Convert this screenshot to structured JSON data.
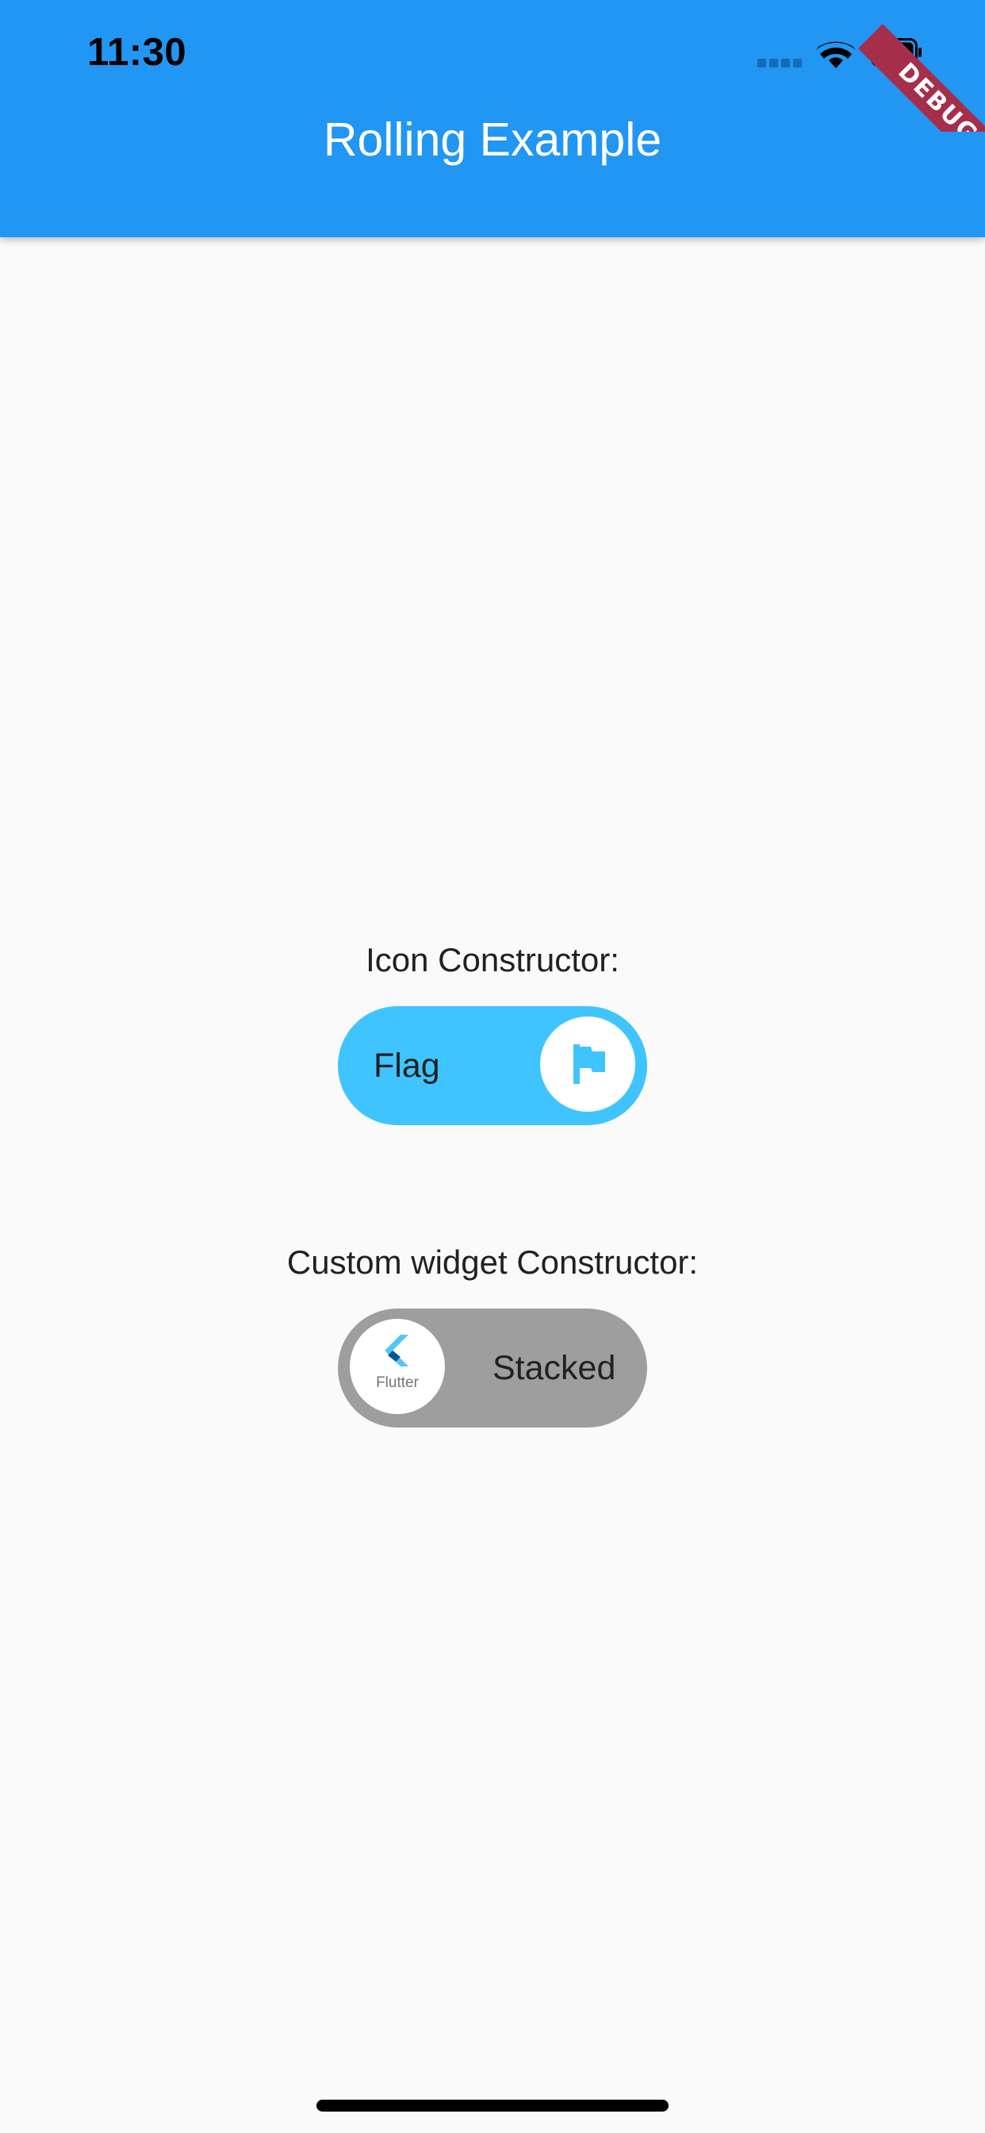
{
  "status_bar": {
    "time": "11:30"
  },
  "debug_banner": {
    "label": "DEBUG",
    "color": "#a52f4b"
  },
  "app_bar": {
    "title": "Rolling Example",
    "color": "#2196f3"
  },
  "icon_switch": {
    "label": "Icon Constructor:",
    "text": "Flag",
    "icon": "flag-icon",
    "state": "on",
    "track_color": "#40c4ff"
  },
  "widget_switch": {
    "label": "Custom widget Constructor:",
    "text": "Stacked",
    "knob_caption": "Flutter",
    "icon": "flutter-logo",
    "state": "off",
    "track_color": "#9e9e9e"
  }
}
